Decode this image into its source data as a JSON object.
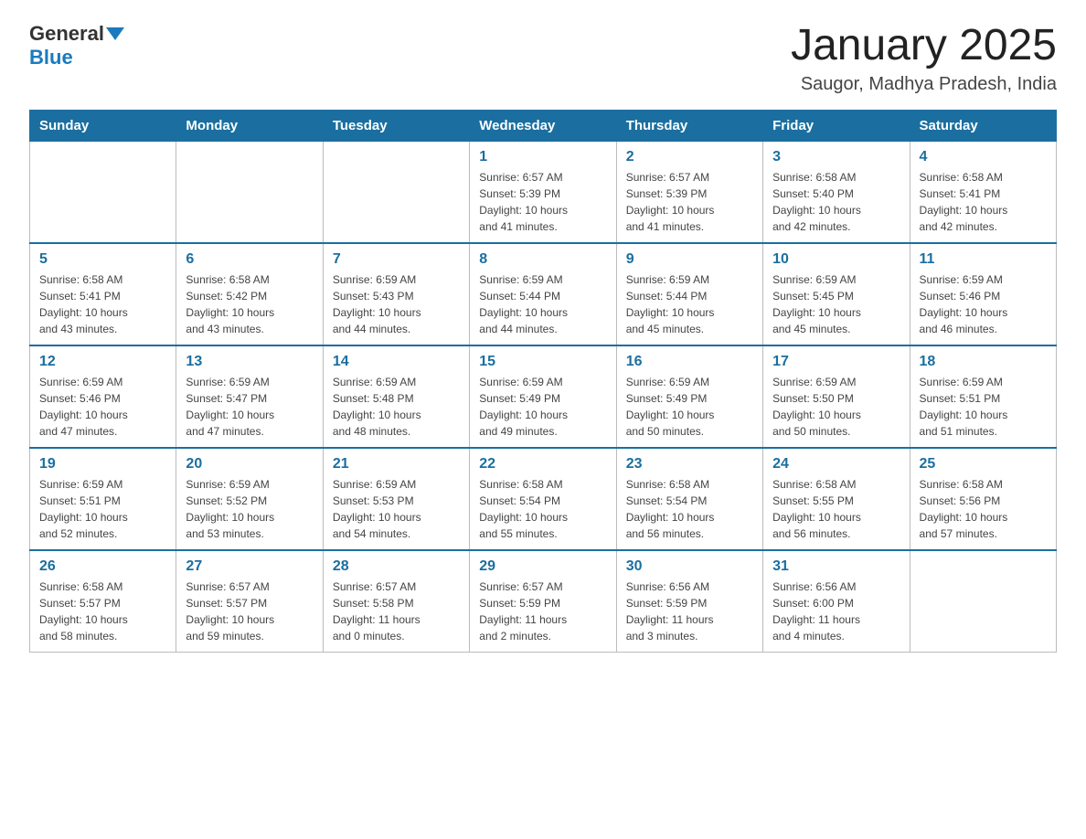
{
  "header": {
    "logo_general": "General",
    "logo_blue": "Blue",
    "month_title": "January 2025",
    "location": "Saugor, Madhya Pradesh, India"
  },
  "days_of_week": [
    "Sunday",
    "Monday",
    "Tuesday",
    "Wednesday",
    "Thursday",
    "Friday",
    "Saturday"
  ],
  "weeks": [
    [
      {
        "day": "",
        "info": ""
      },
      {
        "day": "",
        "info": ""
      },
      {
        "day": "",
        "info": ""
      },
      {
        "day": "1",
        "info": "Sunrise: 6:57 AM\nSunset: 5:39 PM\nDaylight: 10 hours\nand 41 minutes."
      },
      {
        "day": "2",
        "info": "Sunrise: 6:57 AM\nSunset: 5:39 PM\nDaylight: 10 hours\nand 41 minutes."
      },
      {
        "day": "3",
        "info": "Sunrise: 6:58 AM\nSunset: 5:40 PM\nDaylight: 10 hours\nand 42 minutes."
      },
      {
        "day": "4",
        "info": "Sunrise: 6:58 AM\nSunset: 5:41 PM\nDaylight: 10 hours\nand 42 minutes."
      }
    ],
    [
      {
        "day": "5",
        "info": "Sunrise: 6:58 AM\nSunset: 5:41 PM\nDaylight: 10 hours\nand 43 minutes."
      },
      {
        "day": "6",
        "info": "Sunrise: 6:58 AM\nSunset: 5:42 PM\nDaylight: 10 hours\nand 43 minutes."
      },
      {
        "day": "7",
        "info": "Sunrise: 6:59 AM\nSunset: 5:43 PM\nDaylight: 10 hours\nand 44 minutes."
      },
      {
        "day": "8",
        "info": "Sunrise: 6:59 AM\nSunset: 5:44 PM\nDaylight: 10 hours\nand 44 minutes."
      },
      {
        "day": "9",
        "info": "Sunrise: 6:59 AM\nSunset: 5:44 PM\nDaylight: 10 hours\nand 45 minutes."
      },
      {
        "day": "10",
        "info": "Sunrise: 6:59 AM\nSunset: 5:45 PM\nDaylight: 10 hours\nand 45 minutes."
      },
      {
        "day": "11",
        "info": "Sunrise: 6:59 AM\nSunset: 5:46 PM\nDaylight: 10 hours\nand 46 minutes."
      }
    ],
    [
      {
        "day": "12",
        "info": "Sunrise: 6:59 AM\nSunset: 5:46 PM\nDaylight: 10 hours\nand 47 minutes."
      },
      {
        "day": "13",
        "info": "Sunrise: 6:59 AM\nSunset: 5:47 PM\nDaylight: 10 hours\nand 47 minutes."
      },
      {
        "day": "14",
        "info": "Sunrise: 6:59 AM\nSunset: 5:48 PM\nDaylight: 10 hours\nand 48 minutes."
      },
      {
        "day": "15",
        "info": "Sunrise: 6:59 AM\nSunset: 5:49 PM\nDaylight: 10 hours\nand 49 minutes."
      },
      {
        "day": "16",
        "info": "Sunrise: 6:59 AM\nSunset: 5:49 PM\nDaylight: 10 hours\nand 50 minutes."
      },
      {
        "day": "17",
        "info": "Sunrise: 6:59 AM\nSunset: 5:50 PM\nDaylight: 10 hours\nand 50 minutes."
      },
      {
        "day": "18",
        "info": "Sunrise: 6:59 AM\nSunset: 5:51 PM\nDaylight: 10 hours\nand 51 minutes."
      }
    ],
    [
      {
        "day": "19",
        "info": "Sunrise: 6:59 AM\nSunset: 5:51 PM\nDaylight: 10 hours\nand 52 minutes."
      },
      {
        "day": "20",
        "info": "Sunrise: 6:59 AM\nSunset: 5:52 PM\nDaylight: 10 hours\nand 53 minutes."
      },
      {
        "day": "21",
        "info": "Sunrise: 6:59 AM\nSunset: 5:53 PM\nDaylight: 10 hours\nand 54 minutes."
      },
      {
        "day": "22",
        "info": "Sunrise: 6:58 AM\nSunset: 5:54 PM\nDaylight: 10 hours\nand 55 minutes."
      },
      {
        "day": "23",
        "info": "Sunrise: 6:58 AM\nSunset: 5:54 PM\nDaylight: 10 hours\nand 56 minutes."
      },
      {
        "day": "24",
        "info": "Sunrise: 6:58 AM\nSunset: 5:55 PM\nDaylight: 10 hours\nand 56 minutes."
      },
      {
        "day": "25",
        "info": "Sunrise: 6:58 AM\nSunset: 5:56 PM\nDaylight: 10 hours\nand 57 minutes."
      }
    ],
    [
      {
        "day": "26",
        "info": "Sunrise: 6:58 AM\nSunset: 5:57 PM\nDaylight: 10 hours\nand 58 minutes."
      },
      {
        "day": "27",
        "info": "Sunrise: 6:57 AM\nSunset: 5:57 PM\nDaylight: 10 hours\nand 59 minutes."
      },
      {
        "day": "28",
        "info": "Sunrise: 6:57 AM\nSunset: 5:58 PM\nDaylight: 11 hours\nand 0 minutes."
      },
      {
        "day": "29",
        "info": "Sunrise: 6:57 AM\nSunset: 5:59 PM\nDaylight: 11 hours\nand 2 minutes."
      },
      {
        "day": "30",
        "info": "Sunrise: 6:56 AM\nSunset: 5:59 PM\nDaylight: 11 hours\nand 3 minutes."
      },
      {
        "day": "31",
        "info": "Sunrise: 6:56 AM\nSunset: 6:00 PM\nDaylight: 11 hours\nand 4 minutes."
      },
      {
        "day": "",
        "info": ""
      }
    ]
  ]
}
